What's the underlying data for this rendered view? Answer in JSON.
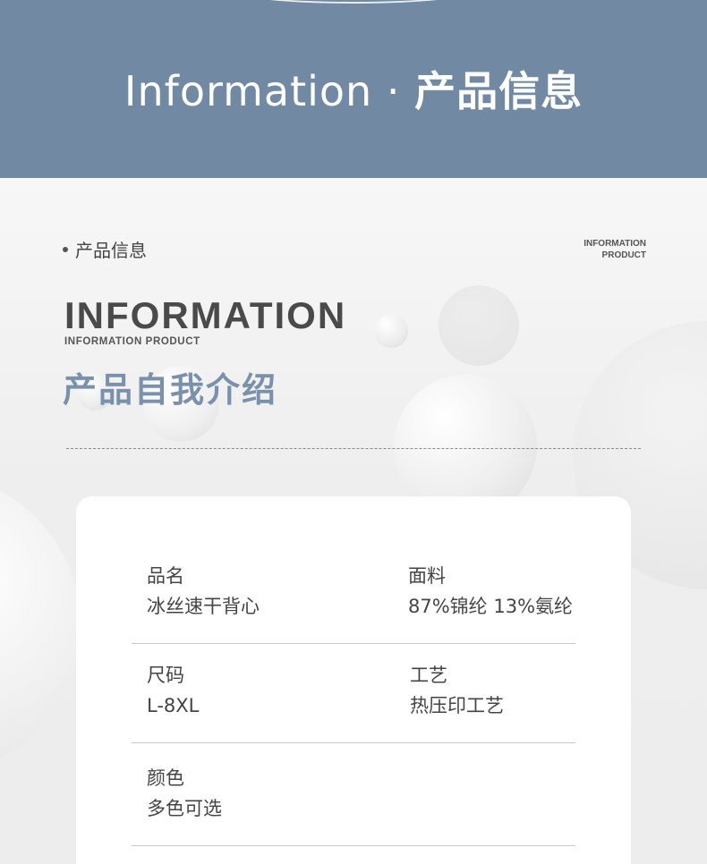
{
  "header": {
    "title_en": "Information",
    "separator": "·",
    "title_cn": "产品信息"
  },
  "section": {
    "label_cn": "产品信息",
    "corner_en_line1": "INFORMATION",
    "corner_en_line2": "PRODUCT",
    "big_en": "INFORMATION",
    "small_en": "INFORMATION PRODUCT",
    "big_cn": "产品自我介绍"
  },
  "specs": [
    {
      "label": "品名",
      "value": "冰丝速干背心"
    },
    {
      "label": "面料",
      "value": "87%锦纶 13%氨纶"
    },
    {
      "label": "尺码",
      "value": "L-8XL"
    },
    {
      "label": "工艺",
      "value": "热压印工艺"
    },
    {
      "label": "颜色",
      "value": "多色可选"
    }
  ],
  "colors": {
    "header_bg": "#7289a4",
    "accent_text": "#7a91ab",
    "card_bg": "#ffffff"
  }
}
